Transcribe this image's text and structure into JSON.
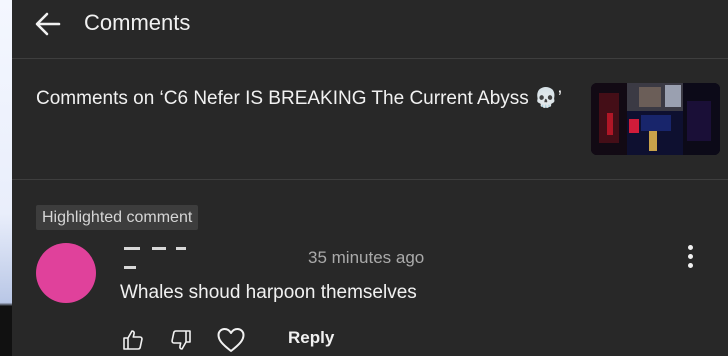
{
  "header": {
    "title": "Comments"
  },
  "video": {
    "title": "Comments on ‘C6 Nefer IS BREAKING The Current Abyss 💀’"
  },
  "comment": {
    "badge": "Highlighted comment",
    "author": "",
    "timestamp": "35 minutes ago",
    "text": "Whales shoud harpoon themselves",
    "reply_label": "Reply",
    "avatar_color": "#e0419b"
  },
  "icons": {
    "back": "arrow-left-icon",
    "menu": "more-vert-icon",
    "like": "thumb-up-icon",
    "dislike": "thumb-down-icon",
    "heart": "heart-icon"
  }
}
